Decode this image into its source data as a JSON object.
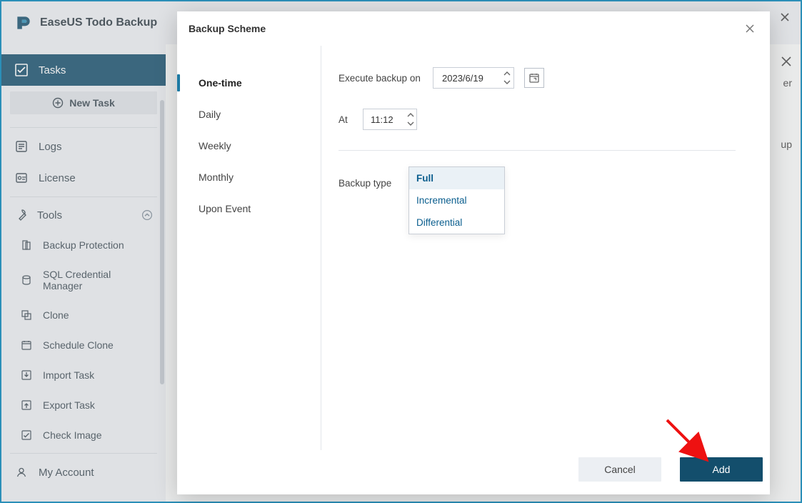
{
  "app_title": "EaseUS Todo Backup",
  "sidebar": {
    "tasks": "Tasks",
    "new_task": "New Task",
    "logs": "Logs",
    "license": "License",
    "tools": "Tools",
    "tools_items": {
      "backup_protection": "Backup Protection",
      "sql_manager": "SQL Credential Manager",
      "clone": "Clone",
      "schedule_clone": "Schedule Clone",
      "import_task": "Import Task",
      "export_task": "Export Task",
      "check_image": "Check Image"
    },
    "my_account": "My Account"
  },
  "bg": {
    "right1": "er",
    "right2": "up"
  },
  "modal": {
    "title": "Backup Scheme",
    "nav": {
      "one_time": "One-time",
      "daily": "Daily",
      "weekly": "Weekly",
      "monthly": "Monthly",
      "upon_event": "Upon Event"
    },
    "labels": {
      "execute": "Execute backup on",
      "at": "At",
      "backup_type": "Backup type"
    },
    "values": {
      "date": "2023/6/19",
      "time": "11:12",
      "type_selected": "Full"
    },
    "dropdown": {
      "opt_full": "Full",
      "opt_incremental": "Incremental",
      "opt_differential": "Differential"
    },
    "buttons": {
      "cancel": "Cancel",
      "add": "Add"
    }
  }
}
